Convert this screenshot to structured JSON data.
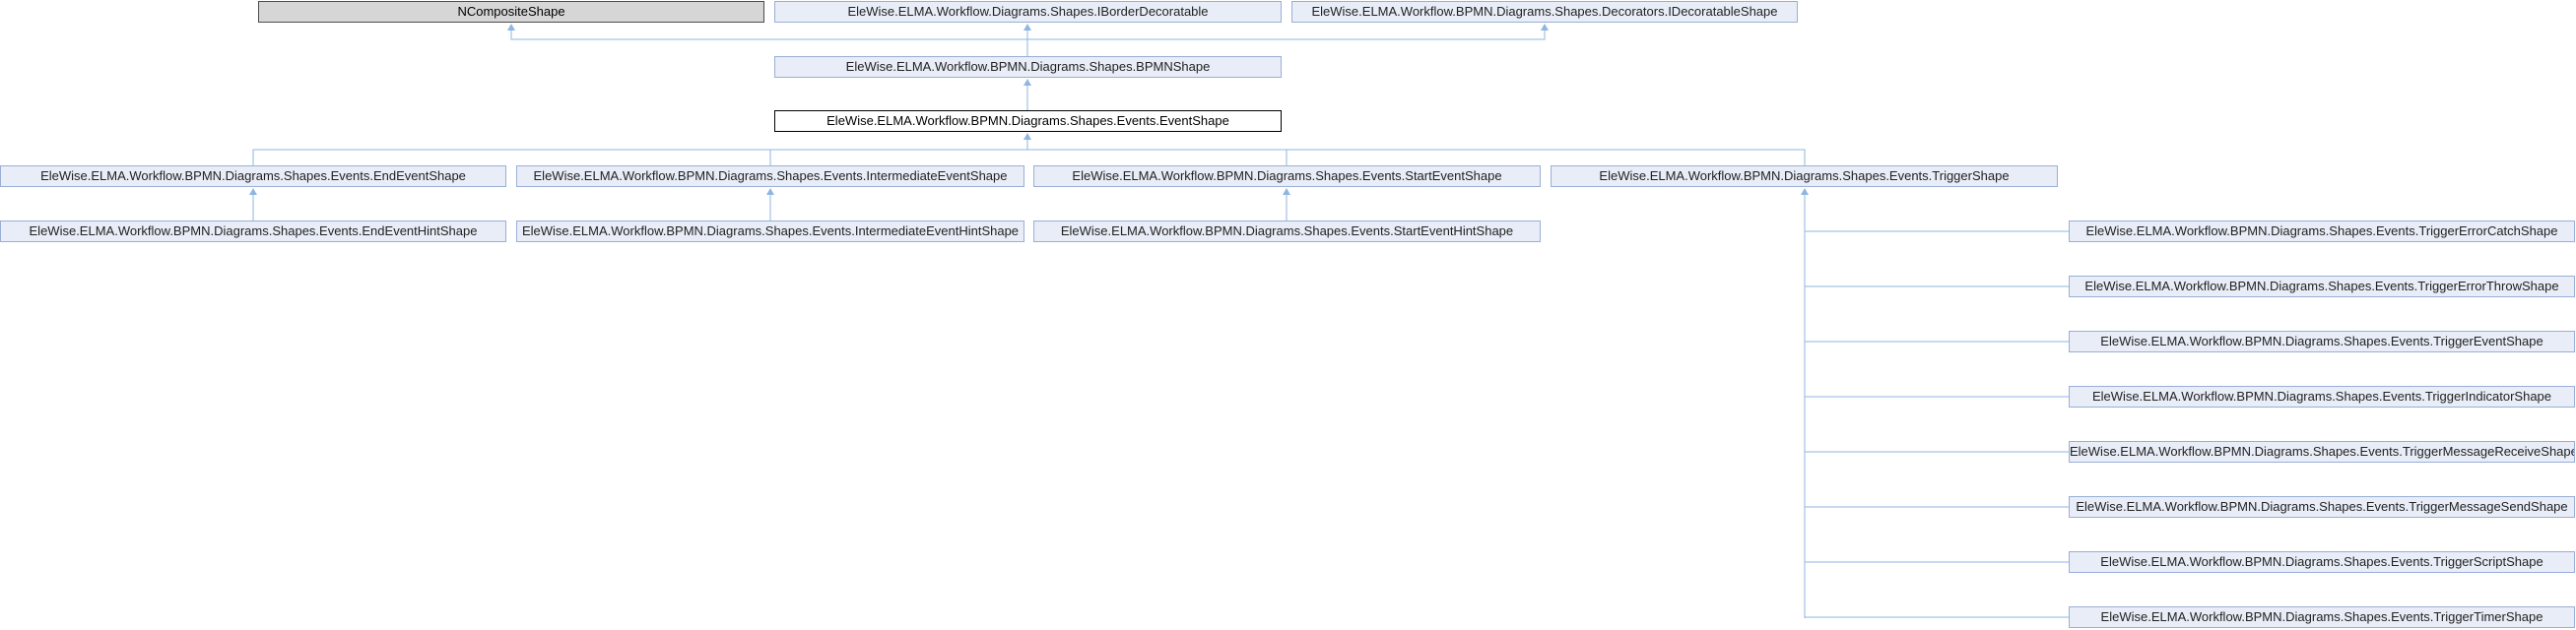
{
  "nodes": {
    "ncomposite": "NCompositeShape",
    "iborder": "EleWise.ELMA.Workflow.Diagrams.Shapes.IBorderDecoratable",
    "idecoratable": "EleWise.ELMA.Workflow.BPMN.Diagrams.Shapes.Decorators.IDecoratableShape",
    "bpmnshape": "EleWise.ELMA.Workflow.BPMN.Diagrams.Shapes.BPMNShape",
    "eventshape": "EleWise.ELMA.Workflow.BPMN.Diagrams.Shapes.Events.EventShape",
    "endevent": "EleWise.ELMA.Workflow.BPMN.Diagrams.Shapes.Events.EndEventShape",
    "intermediateevent": "EleWise.ELMA.Workflow.BPMN.Diagrams.Shapes.Events.IntermediateEventShape",
    "startevent": "EleWise.ELMA.Workflow.BPMN.Diagrams.Shapes.Events.StartEventShape",
    "trigger": "EleWise.ELMA.Workflow.BPMN.Diagrams.Shapes.Events.TriggerShape",
    "endeventhint": "EleWise.ELMA.Workflow.BPMN.Diagrams.Shapes.Events.EndEventHintShape",
    "intermediateeventhint": "EleWise.ELMA.Workflow.BPMN.Diagrams.Shapes.Events.IntermediateEventHintShape",
    "starteventhint": "EleWise.ELMA.Workflow.BPMN.Diagrams.Shapes.Events.StartEventHintShape",
    "triggererrorcatch": "EleWise.ELMA.Workflow.BPMN.Diagrams.Shapes.Events.TriggerErrorCatchShape",
    "triggererrorthrow": "EleWise.ELMA.Workflow.BPMN.Diagrams.Shapes.Events.TriggerErrorThrowShape",
    "triggerevent": "EleWise.ELMA.Workflow.BPMN.Diagrams.Shapes.Events.TriggerEventShape",
    "triggerindicator": "EleWise.ELMA.Workflow.BPMN.Diagrams.Shapes.Events.TriggerIndicatorShape",
    "triggermessagereceive": "EleWise.ELMA.Workflow.BPMN.Diagrams.Shapes.Events.TriggerMessageReceiveShape",
    "triggermessagesend": "EleWise.ELMA.Workflow.BPMN.Diagrams.Shapes.Events.TriggerMessageSendShape",
    "triggerscript": "EleWise.ELMA.Workflow.BPMN.Diagrams.Shapes.Events.TriggerScriptShape",
    "triggertimer": "EleWise.ELMA.Workflow.BPMN.Diagrams.Shapes.Events.TriggerTimerShape"
  },
  "colors": {
    "node_fill": "#e8edf7",
    "node_border": "#9aafd5",
    "edge": "#8fb6e0",
    "external_fill": "#d6d6d6",
    "current_border": "#000000"
  }
}
